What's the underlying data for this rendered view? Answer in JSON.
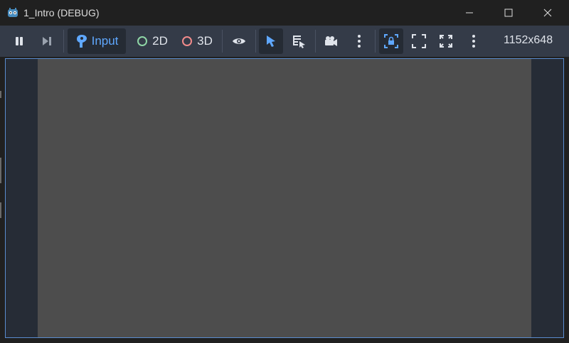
{
  "window": {
    "title": "1_Intro (DEBUG)",
    "minimize_icon": "minimize-icon",
    "maximize_icon": "maximize-icon",
    "close_icon": "close-icon"
  },
  "toolbar": {
    "pause_icon": "pause-icon",
    "step_icon": "next-frame-icon",
    "input_label": "Input",
    "mode_2d_label": "2D",
    "mode_3d_label": "3D",
    "visibility_icon": "eye-icon",
    "select_icon": "select-arrow-icon",
    "list_select_icon": "list-select-icon",
    "camera_icon": "camera-icon",
    "more_icon": "vertical-ellipsis-icon",
    "lock_icon": "camera-lock-icon",
    "fit_icon": "fit-screen-icon",
    "expand_icon": "expand-icon",
    "resolution": "1152x648"
  },
  "colors": {
    "accent": "#5fa8ff",
    "toolbar_bg": "#343b48",
    "canvas_bg": "#4d4d4d",
    "letterbox_bg": "#262c36",
    "mode_2d_ring": "#8fd6a6",
    "mode_3d_ring": "#f28b8b"
  }
}
